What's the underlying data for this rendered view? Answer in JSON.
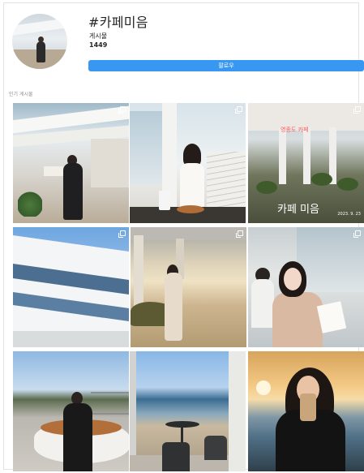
{
  "header": {
    "hashtag": "#카페미음",
    "posts_label": "게시물",
    "posts_count": "1449",
    "follow_label": "팔로우"
  },
  "section": {
    "popular_label": "인기 게시물"
  },
  "grid": {
    "tiles": [
      {
        "name": "post-1",
        "has_multiple": true
      },
      {
        "name": "post-2",
        "has_multiple": true
      },
      {
        "name": "post-3",
        "has_multiple": true,
        "overlay_title": "카페 미음",
        "overlay_red": "영종도 카페",
        "overlay_date": "2023. 9. 23"
      },
      {
        "name": "post-4",
        "has_multiple": true
      },
      {
        "name": "post-5",
        "has_multiple": true
      },
      {
        "name": "post-6",
        "has_multiple": true
      },
      {
        "name": "post-7",
        "has_multiple": false
      },
      {
        "name": "post-8",
        "has_multiple": false
      },
      {
        "name": "post-9",
        "has_multiple": false
      }
    ]
  },
  "colors": {
    "follow_button": "#3897f0",
    "text": "#262626",
    "muted": "#8e8e8e"
  }
}
